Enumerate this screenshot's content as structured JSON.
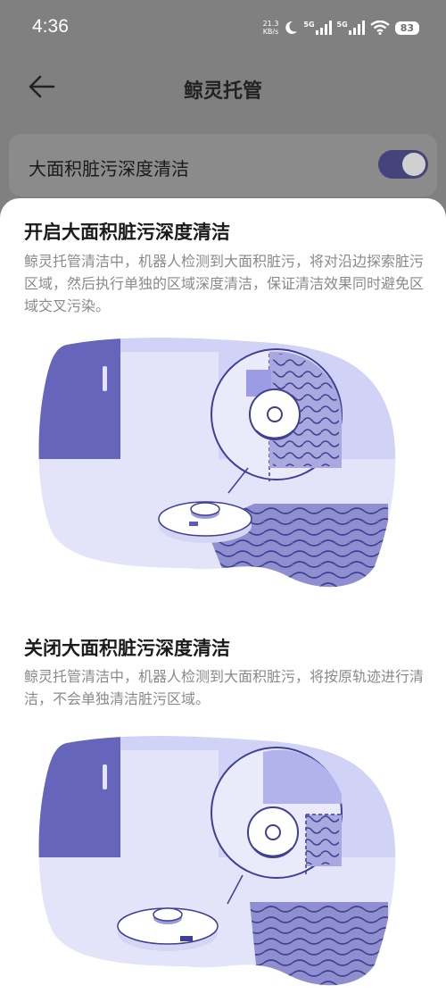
{
  "status": {
    "time": "4:36",
    "net_speed_value": "21.3",
    "net_speed_unit": "KB/s",
    "signal1_label": "5G",
    "signal2_label": "5G",
    "battery": "83"
  },
  "header": {
    "title": "鲸灵托管"
  },
  "setting": {
    "label": "大面积脏污深度清洁",
    "enabled": true
  },
  "sections": [
    {
      "title": "开启大面积脏污深度清洁",
      "description": "鲸灵托管清洁中，机器人检测到大面积脏污，将对沿边探索脏污区域，然后执行单独的区域深度清洁，保证清洁效果同时避免区域交叉污染。"
    },
    {
      "title": "关闭大面积脏污深度清洁",
      "description": "鲸灵托管清洁中，机器人检测到大面积脏污，将按原轨迹进行清洁，不会单独清洁脏污区域。"
    }
  ],
  "colors": {
    "accent": "#5c5cb8",
    "accent_light": "#e4e5fb",
    "toggle_on": "#44447a"
  }
}
